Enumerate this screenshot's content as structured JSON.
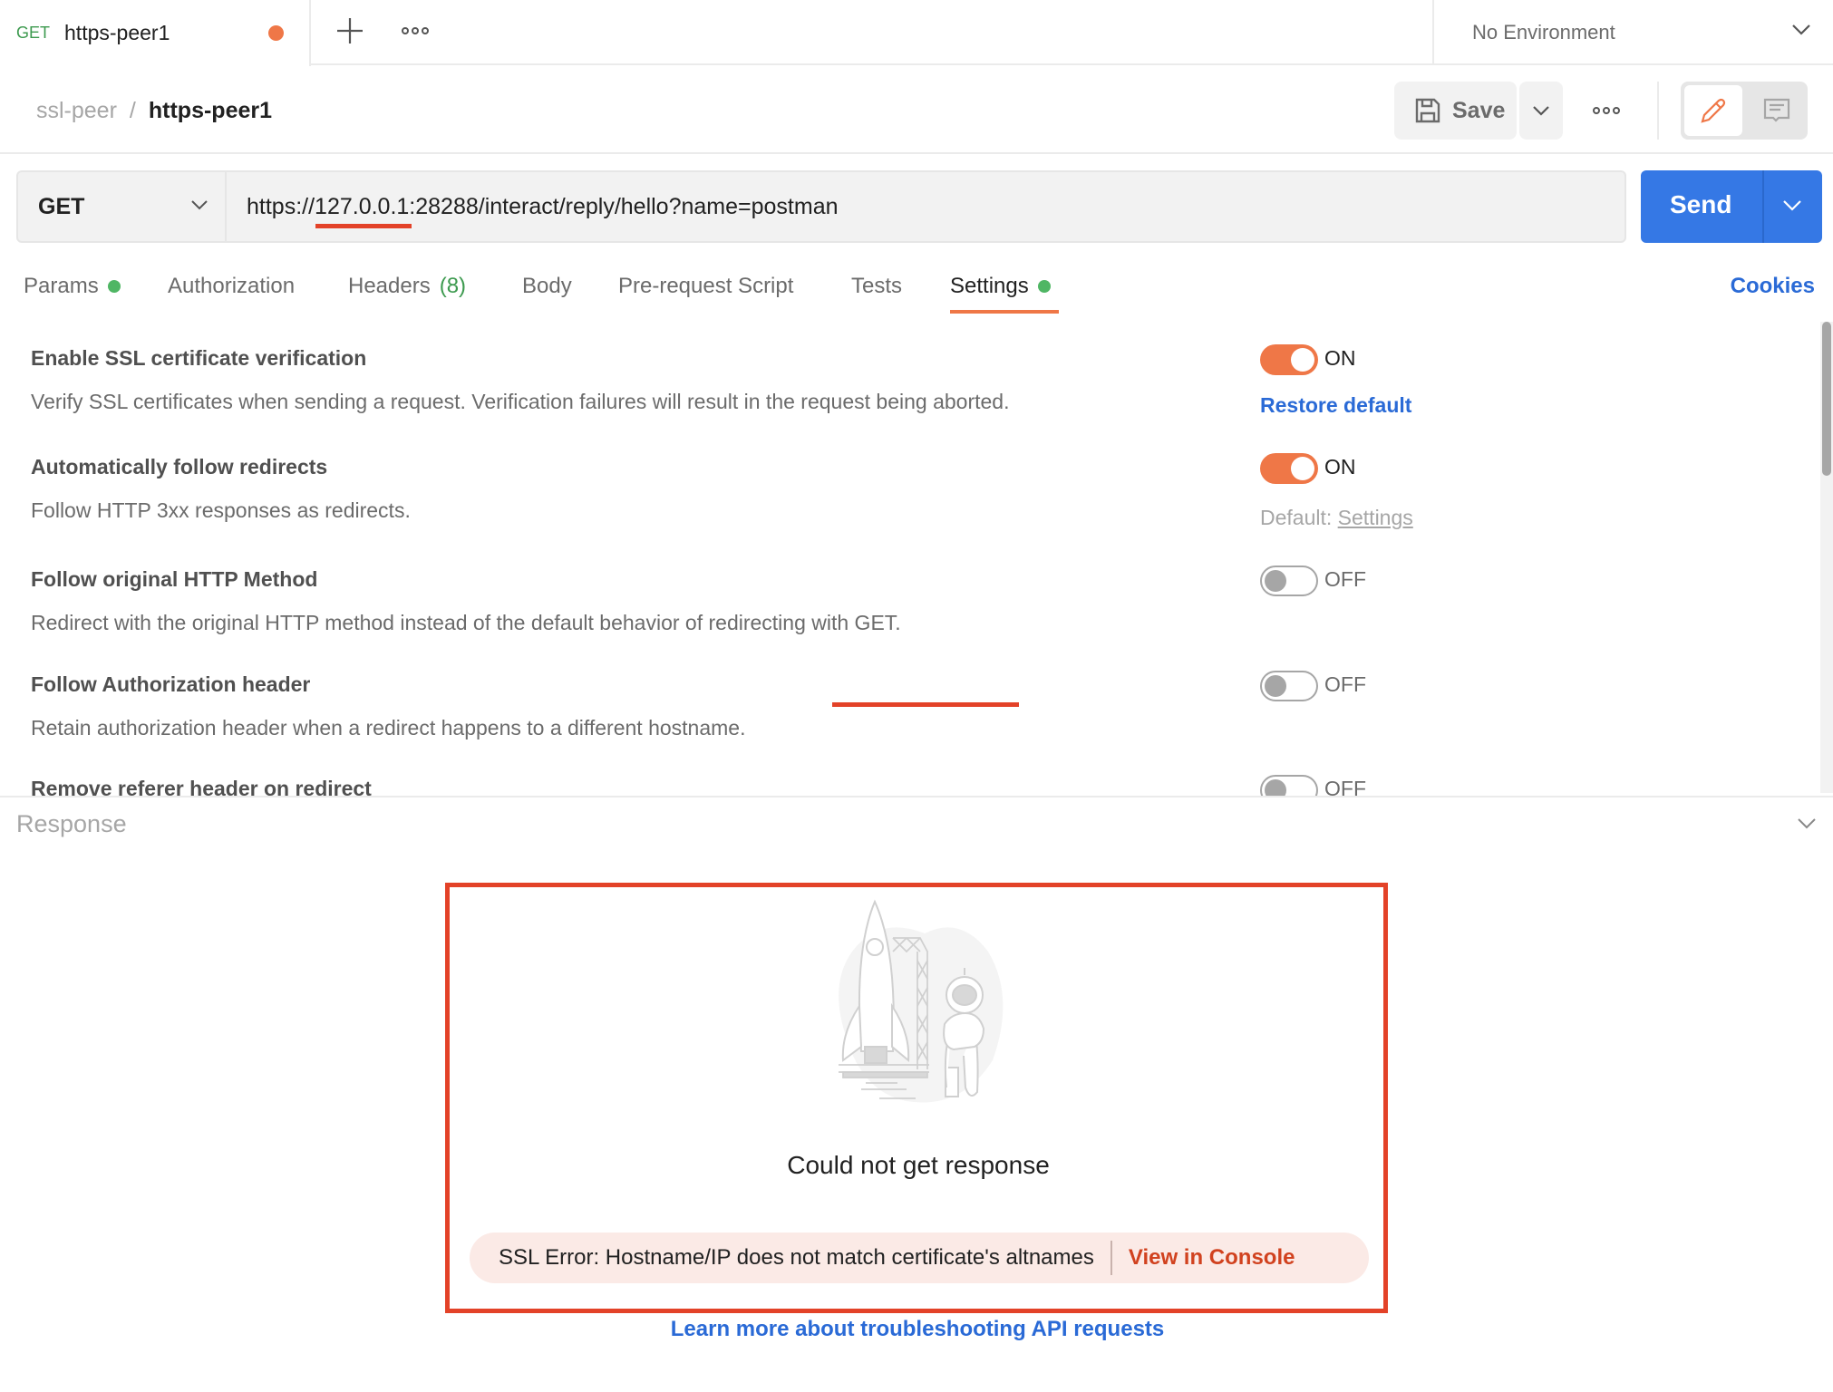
{
  "tab": {
    "method": "GET",
    "name": "https-peer1",
    "unsaved_indicator": "unsaved-dot",
    "new_tab_icon": "plus-icon",
    "more_icon": "more-horizontal-icon"
  },
  "environment": {
    "selected": "No Environment",
    "icon": "chevron-down-icon"
  },
  "breadcrumb": {
    "collection": "ssl-peer",
    "separator": "/",
    "request": "https-peer1"
  },
  "toolbar": {
    "save_label": "Save",
    "save_icon": "floppy-disk-icon",
    "save_dropdown_icon": "chevron-down-icon",
    "more_icon": "more-horizontal-icon",
    "edit_icon": "pencil-icon",
    "comments_icon": "comment-icon"
  },
  "request": {
    "method": "GET",
    "url": "https://127.0.0.1:28288/interact/reply/hello?name=postman",
    "send_label": "Send"
  },
  "tabs": [
    {
      "label": "Params",
      "indicator": "green-dot"
    },
    {
      "label": "Authorization"
    },
    {
      "label": "Headers",
      "count": "(8)"
    },
    {
      "label": "Body"
    },
    {
      "label": "Pre-request Script"
    },
    {
      "label": "Tests"
    },
    {
      "label": "Settings",
      "indicator": "green-dot",
      "active": true
    }
  ],
  "cookies_label": "Cookies",
  "settings": [
    {
      "title": "Enable SSL certificate verification",
      "description": "Verify SSL certificates when sending a request. Verification failures will result in the request being aborted.",
      "state": "ON",
      "enabled": true,
      "extra_link": "Restore default"
    },
    {
      "title": "Automatically follow redirects",
      "description": "Follow HTTP 3xx responses as redirects.",
      "state": "ON",
      "enabled": true,
      "default_label": "Default:",
      "default_link": "Settings"
    },
    {
      "title": "Follow original HTTP Method",
      "description": "Redirect with the original HTTP method instead of the default behavior of redirecting with GET.",
      "state": "OFF",
      "enabled": false
    },
    {
      "title": "Follow Authorization header",
      "description": "Retain authorization header when a redirect happens to a different hostname.",
      "state": "OFF",
      "enabled": false
    },
    {
      "title": "Remove referer header on redirect",
      "state": "OFF",
      "enabled": false
    }
  ],
  "response": {
    "title": "Response",
    "collapse_icon": "chevron-down-icon",
    "illustration": "rocket-astronaut-illustration",
    "message": "Could not get response",
    "error": "SSL Error: Hostname/IP does not match certificate's altnames",
    "console_link": "View in Console",
    "learn_more": "Learn more about troubleshooting API requests"
  },
  "colors": {
    "accent_orange": "#ef7747",
    "send_blue": "#3578e5",
    "link_blue": "#2a6ad6",
    "status_green": "#4fb664",
    "annotation_red": "#e34228",
    "error_bg": "#fbeae6",
    "error_link": "#d1421f"
  }
}
